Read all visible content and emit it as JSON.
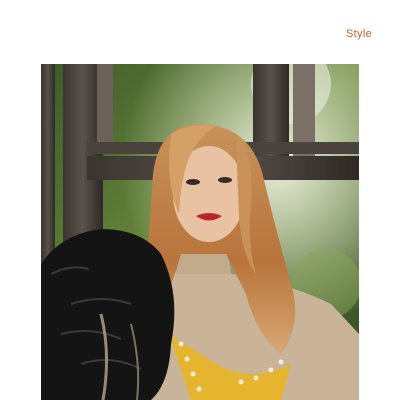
{
  "header": {
    "category_label": "Style"
  },
  "photo": {
    "subject": "portrait-photo"
  },
  "colors": {
    "accent": "#c0602a"
  }
}
